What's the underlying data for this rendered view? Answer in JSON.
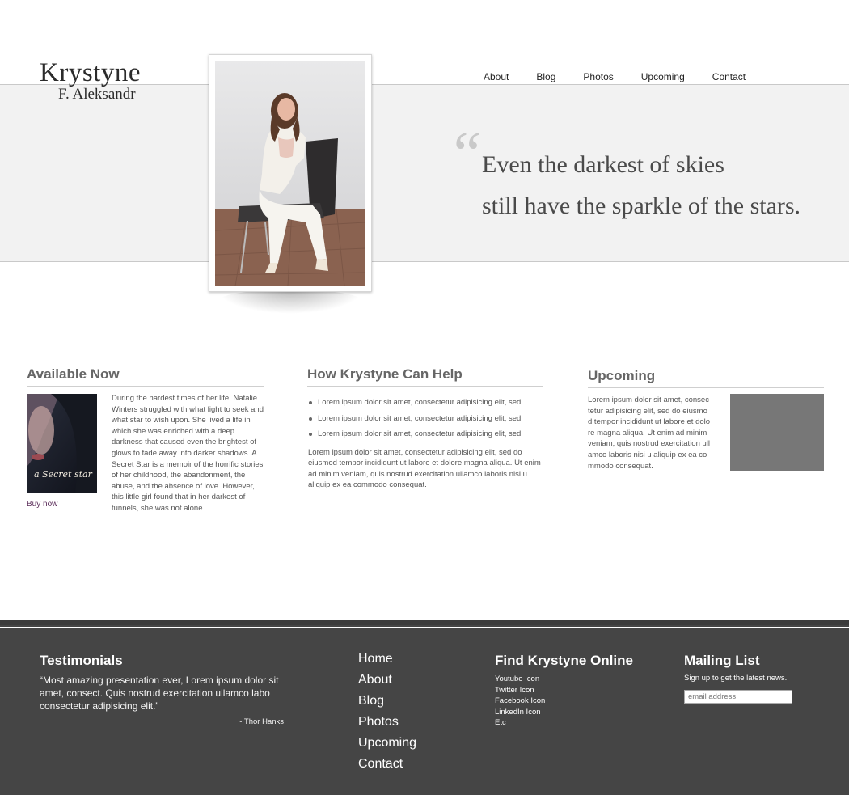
{
  "logo": {
    "first": "Krystyne",
    "last": "F. Aleksandr"
  },
  "nav": [
    "About",
    "Blog",
    "Photos",
    "Upcoming",
    "Contact"
  ],
  "hero": {
    "quote_mark": "“",
    "quote_line1": "Even the darkest of skies",
    "quote_line2": "still have the sparkle of the stars."
  },
  "available": {
    "title": "Available Now",
    "book_title": "a Secret star",
    "buy_label": "Buy now",
    "description": "During the hardest times of her life, Natalie Winters struggled with what light to seek and what star to wish upon. She lived a life in which she was enriched with a deep darkness that caused even the brightest of glows to fade away into darker shadows. A Secret Star is a memoir of the horrific stories of her childhood, the abandonment, the abuse, and the absence of love. However, this little girl found that in her darkest of tunnels, she was not alone."
  },
  "help": {
    "title": "How Krystyne Can Help",
    "items": [
      "Lorem ipsum dolor sit amet, consectetur adipisicing elit, sed",
      "Lorem ipsum dolor sit amet, consectetur adipisicing elit, sed",
      "Lorem ipsum dolor sit amet, consectetur adipisicing elit, sed"
    ],
    "paragraph": "Lorem ipsum dolor sit amet, consectetur adipisicing elit, sed do eiusmod tempor incididunt ut labore et dolore magna aliqua. Ut enim ad minim veniam, quis nostrud exercitation ullamco laboris nisi u aliquip ex ea commodo consequat."
  },
  "upcoming": {
    "title": "Upcoming",
    "text": "Lorem ipsum dolor sit amet, consectetur adipisicing elit, sed do eiusmod tempor incididunt ut labore et dolore magna aliqua. Ut enim ad minim veniam, quis nostrud exercitation ullamco laboris nisi u aliquip ex ea commodo consequat."
  },
  "footer": {
    "testimonials_title": "Testimonials",
    "testimonial_quote": "“Most amazing presentation ever, Lorem ipsum dolor sit amet, consect. Quis nostrud exercitation ullamco labo consectetur adipisicing elit.”",
    "testimonial_author": "- Thor Hanks",
    "nav": [
      "Home",
      "About",
      "Blog",
      "Photos",
      "Upcoming",
      "Contact"
    ],
    "online_title": "Find Krystyne Online",
    "online_links": [
      "Youtube Icon",
      "Twitter Icon",
      "Facebook Icon",
      "LinkedIn Icon",
      "Etc"
    ],
    "mail_title": "Mailing List",
    "mail_sub": "Sign up to get the latest news.",
    "mail_placeholder": "email address"
  },
  "colors": {
    "hero_band": "#f2f2f2",
    "footer_bg": "#454545",
    "link_purple": "#5b2d5a",
    "placeholder_box": "#777777"
  }
}
